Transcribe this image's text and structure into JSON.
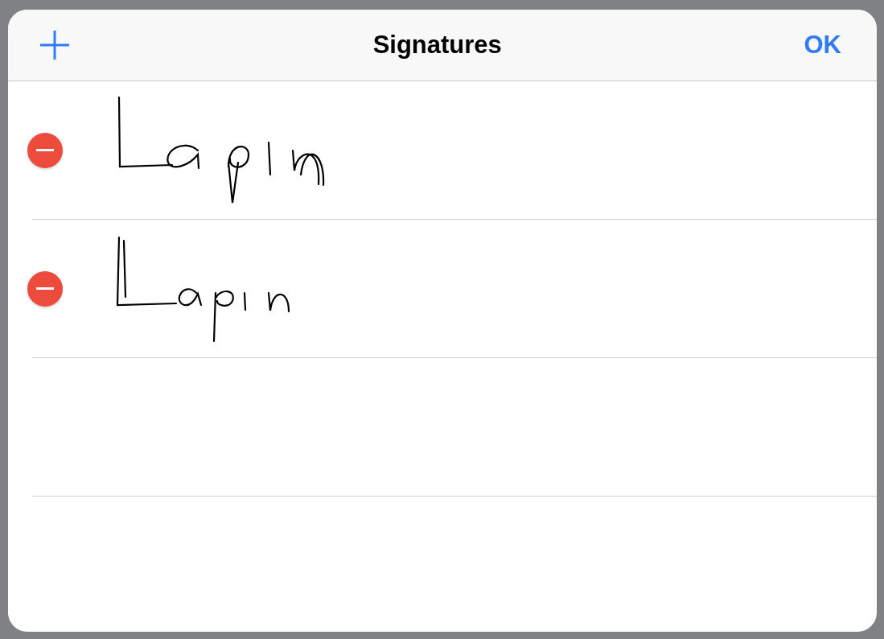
{
  "dialog": {
    "title": "Signatures",
    "confirm": "OK",
    "rows": [
      {
        "kind": "signature"
      },
      {
        "kind": "signature"
      },
      {
        "kind": "empty"
      }
    ]
  }
}
